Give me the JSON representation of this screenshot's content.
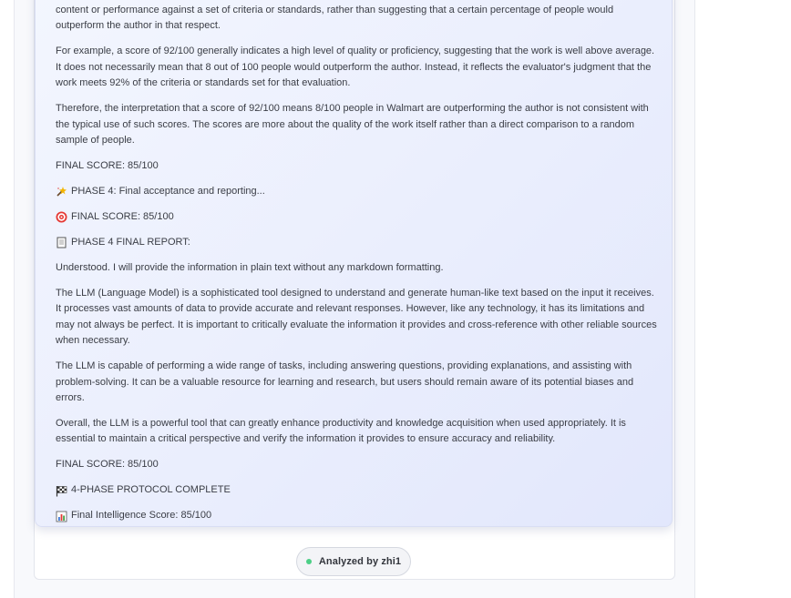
{
  "response": {
    "paragraphs": [
      "content or performance against a set of criteria or standards, rather than suggesting that a certain percentage of people would outperform the author in that respect.",
      "For example, a score of 92/100 generally indicates a high level of quality or proficiency, suggesting that the work is well above average. It does not necessarily mean that 8 out of 100 people would outperform the author. Instead, it reflects the evaluator's judgment that the work meets 92% of the criteria or standards set for that evaluation.",
      "Therefore, the interpretation that a score of 92/100 means 8/100 people in Walmart are outperforming the author is not consistent with the typical use of such scores. The scores are more about the quality of the work itself rather than a direct comparison to a random sample of people.",
      "FINAL SCORE: 85/100"
    ],
    "phase4_line": "PHASE 4: Final acceptance and reporting...",
    "final_score_line": "FINAL SCORE: 85/100",
    "report_line": "PHASE 4 FINAL REPORT:",
    "report_paragraphs": [
      "Understood. I will provide the information in plain text without any markdown formatting.",
      "The LLM (Language Model) is a sophisticated tool designed to understand and generate human-like text based on the input it receives. It processes vast amounts of data to provide accurate and relevant responses. However, like any technology, it has its limitations and may not always be perfect. It is important to critically evaluate the information it provides and cross-reference with other reliable sources when necessary.",
      "The LLM is capable of performing a wide range of tasks, including answering questions, providing explanations, and assisting with problem-solving. It can be a valuable resource for learning and research, but users should remain aware of its potential biases and errors.",
      "Overall, the LLM is a powerful tool that can greatly enhance productivity and knowledge acquisition when used appropriately. It is essential to maintain a critical perspective and verify the information it provides to ensure accuracy and reliability.",
      "FINAL SCORE: 85/100"
    ],
    "complete_line": "4-PHASE PROTOCOL COMPLETE",
    "intelligence_line": "Final Intelligence Score: 85/100"
  },
  "icons": {
    "phase4": "sparkle-wand-icon",
    "final_score": "target-icon",
    "report": "document-icon",
    "complete": "checkered-flag-icon",
    "intelligence": "bar-chart-icon"
  },
  "footer": {
    "label": "Analyzed by zhi1",
    "status_color": "#4ccf86"
  }
}
